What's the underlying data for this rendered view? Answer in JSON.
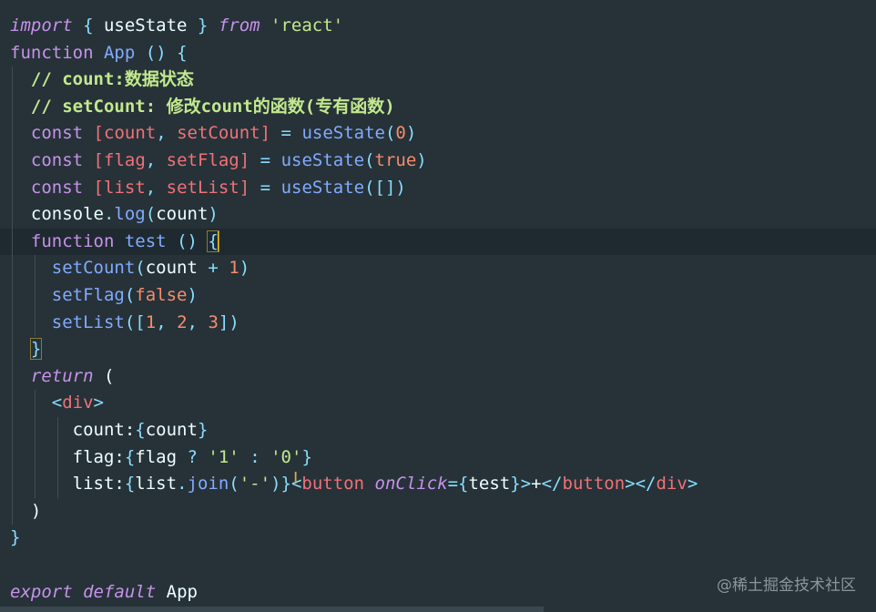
{
  "editor": {
    "language": "javascript-react",
    "lines": [
      "import { useState } from 'react'",
      "function App () {",
      "  // count:数据状态",
      "  // setCount: 修改count的函数(专有函数)",
      "  const [count, setCount] = useState(0)",
      "  const [flag, setFlag] = useState(true)",
      "  const [list, setList] = useState([])",
      "  console.log(count)",
      "  function test () {",
      "    setCount(count + 1)",
      "    setFlag(false)",
      "    setList([1, 2, 3])",
      "  }",
      "  return (",
      "    <div>",
      "      count:{count}",
      "      flag:{flag ? '1' : '0'}",
      "      list:{list.join('-')}<button onClick={test}>+</button></div>",
      "  )",
      "}",
      "",
      "export default App"
    ],
    "active_line": 9,
    "cursor_icon": "text-cursor-icon",
    "ibeam_icon": "i-beam-cursor-icon"
  },
  "watermark": {
    "text": "@稀土掘金技术社区"
  },
  "colors": {
    "background": "#263238",
    "keyword": "#c792ea",
    "function": "#82aaff",
    "string": "#c3e88d",
    "number": "#f78c6c",
    "punctuation": "#89ddff",
    "tag": "#f07178",
    "text": "#eeffff"
  }
}
